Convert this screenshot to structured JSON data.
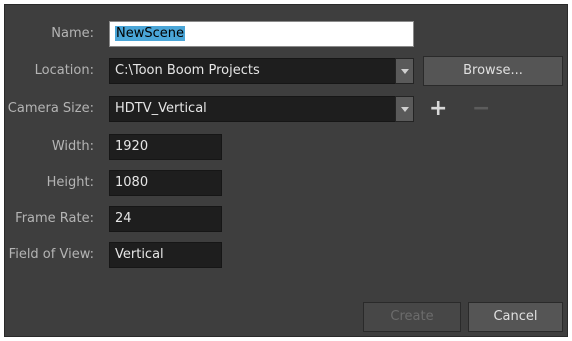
{
  "dialog": {
    "name": {
      "label": "Name:",
      "value": "NewScene"
    },
    "location": {
      "label": "Location:",
      "value": "C:\\Toon Boom Projects",
      "browse_label": "Browse..."
    },
    "camera_size": {
      "label": "Camera Size:",
      "value": "HDTV_Vertical",
      "add_symbol": "+",
      "remove_symbol": "−"
    },
    "width": {
      "label": "Width:",
      "value": "1920"
    },
    "height": {
      "label": "Height:",
      "value": "1080"
    },
    "frame_rate": {
      "label": "Frame Rate:",
      "value": "24"
    },
    "field_of_view": {
      "label": "Field of View:",
      "value": "Vertical"
    },
    "create_label": "Create",
    "cancel_label": "Cancel"
  },
  "colors": {
    "background": "#3e3e3e",
    "field": "#1e1e1e",
    "selection": "#4aa6d8",
    "label_text": "#b4b4b4"
  },
  "icons": {
    "dropdown": "chevron-down-icon",
    "add": "plus-icon",
    "remove": "minus-icon"
  }
}
